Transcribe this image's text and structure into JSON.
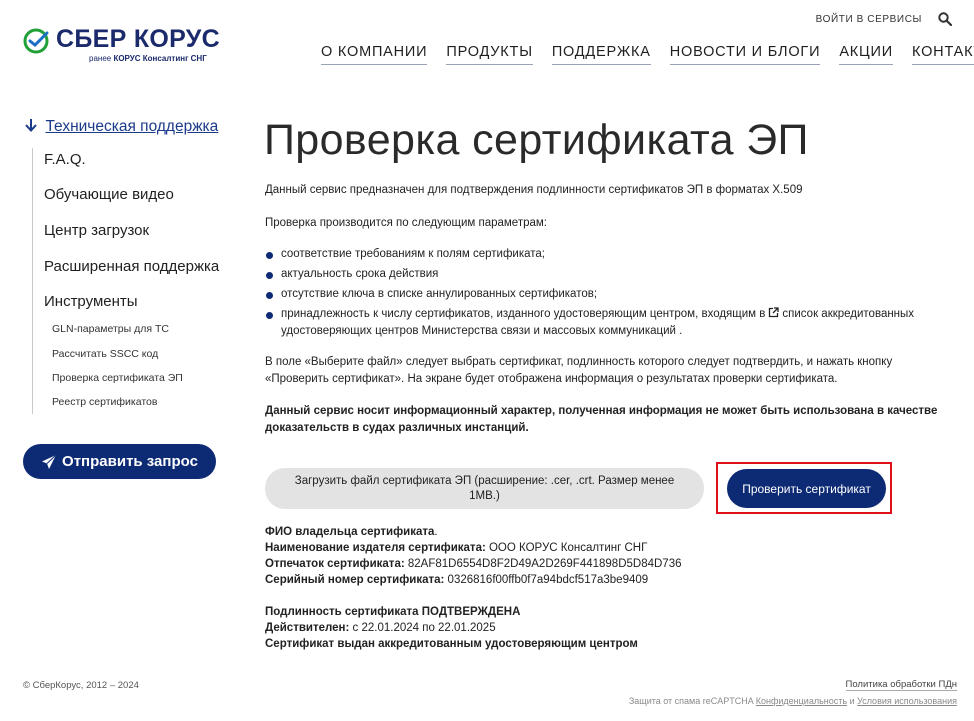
{
  "header": {
    "logo_text": "СБЕР КОРУС",
    "logo_sub_prefix": "ранее ",
    "logo_sub_bold": "КОРУС Консалтинг СНГ",
    "login_label": "ВОЙТИ В СЕРВИСЫ",
    "nav": [
      "О КОМПАНИИ",
      "ПРОДУКТЫ",
      "ПОДДЕРЖКА",
      "НОВОСТИ И БЛОГИ",
      "АКЦИИ",
      "КОНТАКТЫ"
    ]
  },
  "sidebar": {
    "section_label": "Техническая поддержка",
    "items": [
      "F.A.Q.",
      "Обучающие видео",
      "Центр загрузок",
      "Расширенная поддержка",
      "Инструменты"
    ],
    "tools": [
      "GLN-параметры для ТС",
      "Рассчитать SSCC код",
      "Проверка сертификата ЭП",
      "Реестр сертификатов"
    ],
    "send_button": "Отправить запрос"
  },
  "main": {
    "title": "Проверка сертификата ЭП",
    "intro": "Данный сервис предназначен для подтверждения подлинности сертификатов ЭП в форматах X.509",
    "params_heading": "Проверка производится по следующим параметрам:",
    "bullets": [
      "соответствие требованиям к полям сертификата;",
      "актуальность срока действия",
      "отсутствие ключа в списке аннулированных сертификатов;"
    ],
    "bullet4_text": "принадлежность к числу сертификатов, изданного удостоверяющим центром, входящим в",
    "bullet4_link": "список аккредитованных удостоверяющих центров Министерства связи и массовых коммуникаций",
    "bullet4_end": " .",
    "instruction": "В поле «Выберите файл» следует выбрать сертификат, подлинность которого следует подтвердить, и нажать кнопку «Проверить сертификат». На экране будет отображена информация о результатах проверки сертификата.",
    "disclaimer": "Данный сервис носит информационный характер, полученная информация не может быть использована в качестве доказательств в судах различных инстанций.",
    "upload_label": "Загрузить файл сертификата ЭП (расширение: .cer, .crt. Размер менее 1МВ.)",
    "check_button": "Проверить сертификат"
  },
  "result": {
    "owner_label": "ФИО владельца сертификата",
    "owner_value": ".",
    "issuer_label": "Наименование издателя сертификата:",
    "issuer_value": " ООО КОРУС Консалтинг СНГ",
    "thumb_label": "Отпечаток сертификата:",
    "thumb_value": " 82AF81D6554D8F2D49A2D269F441898D5D84D736",
    "serial_label": "Серийный номер сертификата:",
    "serial_value": " 0326816f00ffb0f7a94bdcf517a3be9409",
    "status_label": "Подлинность сертификата",
    "status_value": " ПОДТВЕРЖДЕНА",
    "valid_label": "Действителен:",
    "valid_value": " с 22.01.2024 по 22.01.2025",
    "issued_by": "Сертификат выдан аккредитованным удостоверяющим центром"
  },
  "footer": {
    "copyright": "© СберКорус, 2012 – 2024",
    "privacy_link": "Политика обработки ПДн",
    "recaptcha_text": "Защита от спама reCAPTCHA ",
    "recaptcha_privacy": "Конфиденциальность",
    "recaptcha_and": " и ",
    "recaptcha_terms": "Условия использования"
  },
  "colors": {
    "brand_navy": "#0d2b74",
    "logo_green": "#21a038",
    "highlight_red": "#e0101b"
  }
}
